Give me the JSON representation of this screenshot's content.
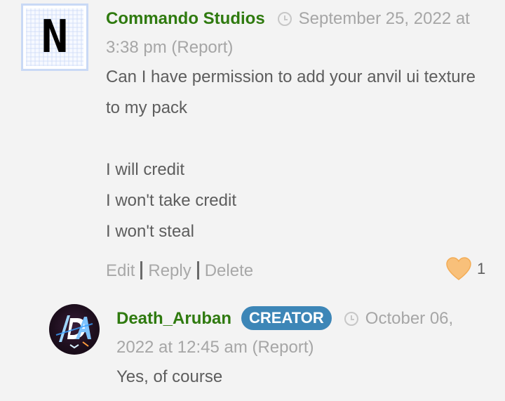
{
  "comment": {
    "author": "Commando Studios",
    "avatar_letter": "N",
    "date_line": "September 25, 2022 at 3:38 pm",
    "report_label": "(Report)",
    "lines": [
      "Can I have permission to add your anvil ui texture to my pack",
      "",
      "I will credit",
      "I won't take credit",
      "I won't steal"
    ],
    "actions": {
      "edit": "Edit",
      "reply": "Reply",
      "delete": "Delete"
    },
    "likes": "1",
    "like_color": "#f8c07a"
  },
  "reply": {
    "author": "Death_Aruban",
    "badge": "CREATOR",
    "badge_color": "#3d86b7",
    "date_line": "October 06, 2022 at 12:45 am",
    "report_label": "(Report)",
    "text": "Yes, of course"
  },
  "colors": {
    "author": "#2f7a0f",
    "meta": "#a6a6a6",
    "body": "#5d5d5d",
    "background": "#f3f3f3"
  }
}
